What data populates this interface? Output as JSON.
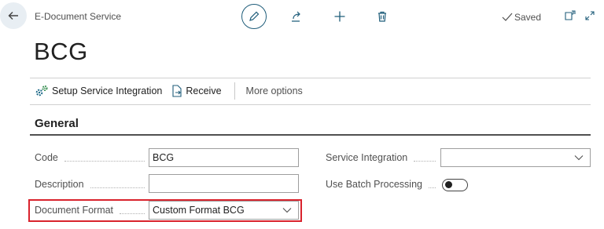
{
  "header": {
    "app_title": "E-Document Service",
    "page_title": "BCG",
    "saved_label": "Saved"
  },
  "actions": {
    "setup_label": "Setup Service Integration",
    "receive_label": "Receive",
    "more_label": "More options"
  },
  "section": {
    "title": "General"
  },
  "fields": {
    "code_label": "Code",
    "code_value": "BCG",
    "description_label": "Description",
    "description_value": "",
    "format_label": "Document Format",
    "format_value": "Custom Format BCG",
    "service_label": "Service Integration",
    "service_value": "",
    "batch_label": "Use Batch Processing",
    "batch_value": false
  },
  "colors": {
    "accent": "#1f5d7a",
    "highlight": "#d9232d",
    "back_button_bg": "#e8eef3"
  }
}
